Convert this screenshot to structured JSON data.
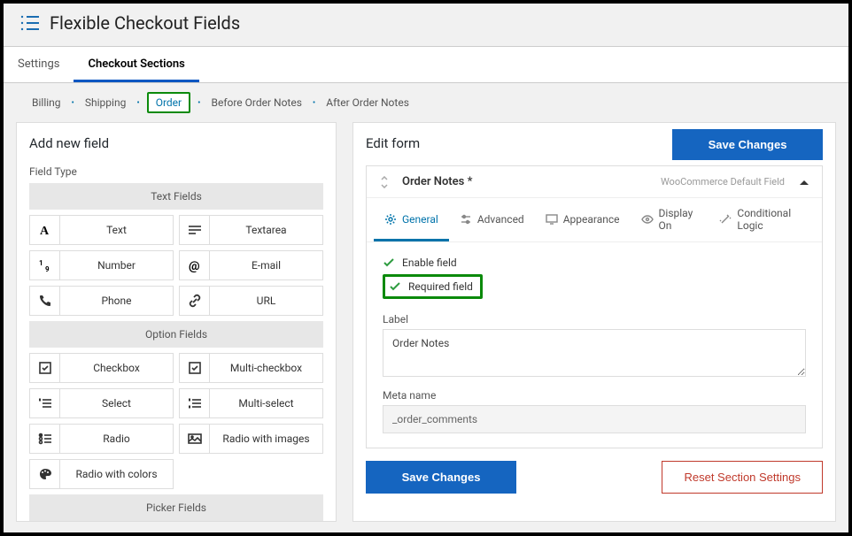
{
  "page_title": "Flexible Checkout Fields",
  "top_tabs": {
    "settings": "Settings",
    "sections": "Checkout Sections"
  },
  "sub_nav": {
    "billing": "Billing",
    "shipping": "Shipping",
    "order": "Order",
    "before_notes": "Before Order Notes",
    "after_notes": "After Order Notes"
  },
  "left": {
    "title": "Add new field",
    "field_type_label": "Field Type",
    "groups": {
      "text": "Text Fields",
      "option": "Option Fields",
      "picker": "Picker Fields"
    },
    "types": {
      "text": "Text",
      "textarea": "Textarea",
      "number": "Number",
      "email": "E-mail",
      "phone": "Phone",
      "url": "URL",
      "checkbox": "Checkbox",
      "multi_checkbox": "Multi-checkbox",
      "select": "Select",
      "multi_select": "Multi-select",
      "radio": "Radio",
      "radio_images": "Radio with images",
      "radio_colors": "Radio with colors"
    }
  },
  "right": {
    "title": "Edit form",
    "save": "Save Changes",
    "reset": "Reset Section Settings",
    "field": {
      "title": "Order Notes *",
      "default_tag": "WooCommerce Default Field",
      "tabs": {
        "general": "General",
        "advanced": "Advanced",
        "appearance": "Appearance",
        "display_on": "Display On",
        "conditional": "Conditional Logic"
      },
      "enable": "Enable field",
      "required": "Required field",
      "label_label": "Label",
      "label_value": "Order Notes",
      "meta_label": "Meta name",
      "meta_value": "_order_comments"
    }
  }
}
